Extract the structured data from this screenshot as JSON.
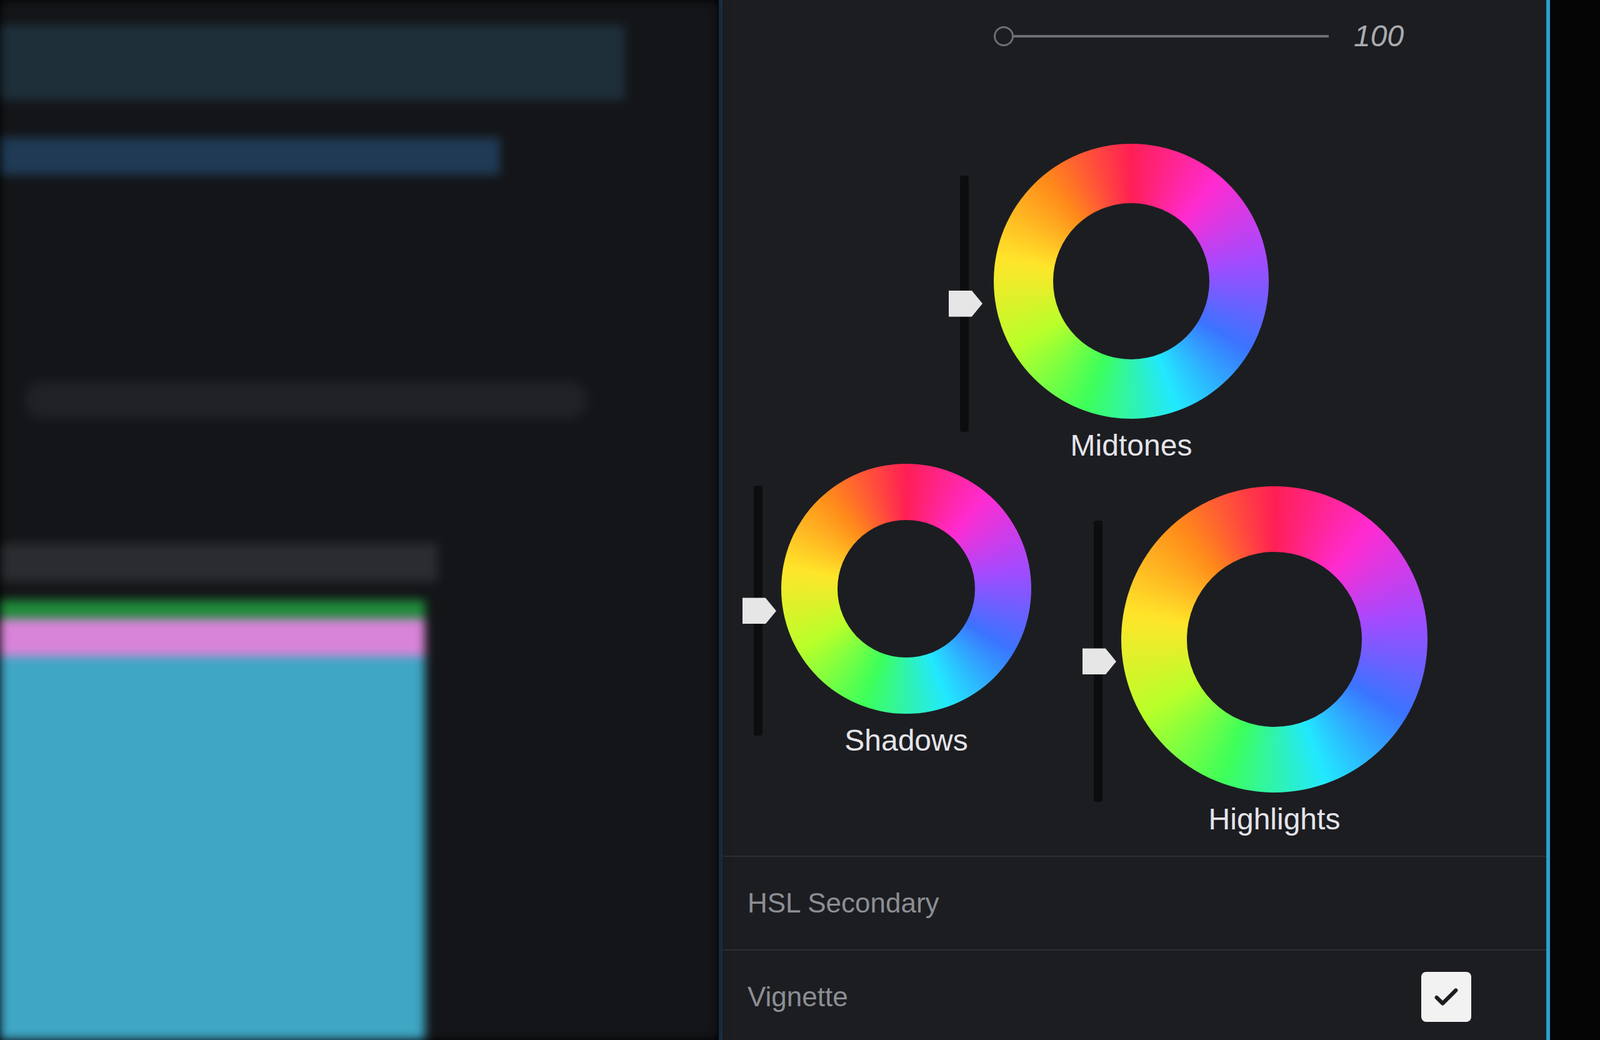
{
  "panel": {
    "top_slider": {
      "value": "100",
      "level": 0
    }
  },
  "wheels": [
    {
      "label": "Midtones",
      "level": 0.5
    },
    {
      "label": "Shadows",
      "level": 0.5
    },
    {
      "label": "Highlights",
      "level": 0.5
    }
  ],
  "sections": [
    {
      "label": "HSL Secondary",
      "kind": "header"
    },
    {
      "label": "Vignette",
      "kind": "checkbox",
      "checked": true
    }
  ]
}
